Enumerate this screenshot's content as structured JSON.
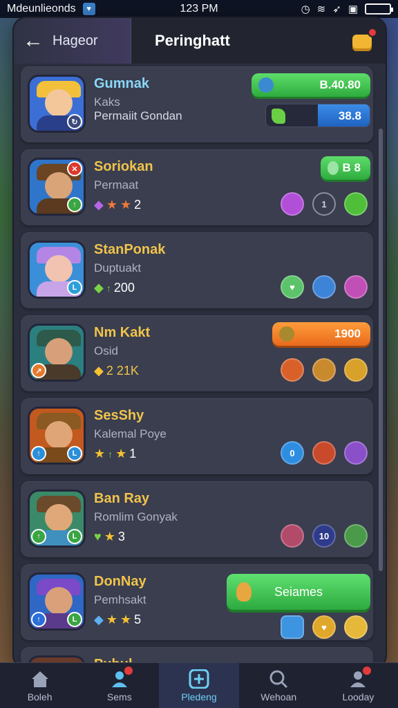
{
  "status_bar": {
    "carrier": "Mdeunlieonds",
    "time": "123 PM"
  },
  "header": {
    "back_label": "Hageor",
    "title": "Peringhatt"
  },
  "players": [
    {
      "name": "Gumnak",
      "line1": "Kaks",
      "line2": "Permaiit Gondan",
      "pill_value": "B.40.80",
      "bar_value": "38.8",
      "avatar_color": "#3c6fd6"
    },
    {
      "name": "Soriokan",
      "line1": "Permaat",
      "stat_value": "2",
      "pill_value": "B 8",
      "icon_center_label": "1",
      "avatar_color": "#2f75c9"
    },
    {
      "name": "StanPonak",
      "line1": "Duptuakt",
      "stat_value": "200",
      "avatar_color": "#3b8fd8"
    },
    {
      "name": "Nm Kakt",
      "line1": "Osid",
      "stat_value": "2 21K",
      "pill_value": "1900",
      "avatar_color": "#2c7f7f"
    },
    {
      "name": "SesShy",
      "line1": "Kalemal Poye",
      "stat_value": "1",
      "icon_first_label": "0",
      "avatar_color": "#c2591f"
    },
    {
      "name": "Ban Ray",
      "line1": "Romlim Gonyak",
      "stat_value": "3",
      "icon_middle_label": "10",
      "avatar_color": "#3a8a6a"
    },
    {
      "name": "DonNay",
      "line1": "Pemhsakt",
      "stat_value": "5",
      "button_label": "Seiames",
      "avatar_color": "#2f67c4"
    },
    {
      "name": "Pubul"
    }
  ],
  "tabs": [
    {
      "label": "Boleh",
      "icon": "home-icon"
    },
    {
      "label": "Sems",
      "icon": "profile-icon"
    },
    {
      "label": "Pledeng",
      "icon": "plus-icon"
    },
    {
      "label": "Wehoan",
      "icon": "search-icon"
    },
    {
      "label": "Looday",
      "icon": "user-icon"
    }
  ]
}
